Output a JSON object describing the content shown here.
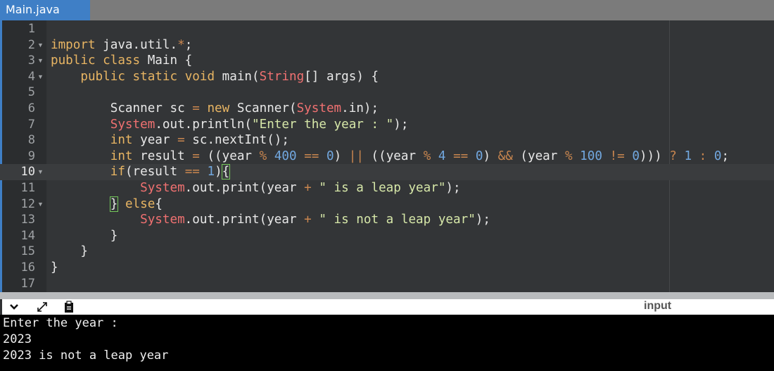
{
  "tab": {
    "label": "Main.java"
  },
  "toolbar": {
    "input_label": "input"
  },
  "editor": {
    "line_numbers": [
      "1",
      "2",
      "3",
      "4",
      "5",
      "6",
      "7",
      "8",
      "9",
      "10",
      "11",
      "12",
      "13",
      "14",
      "15",
      "16",
      "17"
    ],
    "active_line": "10"
  },
  "console": {
    "lines": [
      "Enter the year :",
      "2023",
      "2023 is not a leap year"
    ]
  }
}
